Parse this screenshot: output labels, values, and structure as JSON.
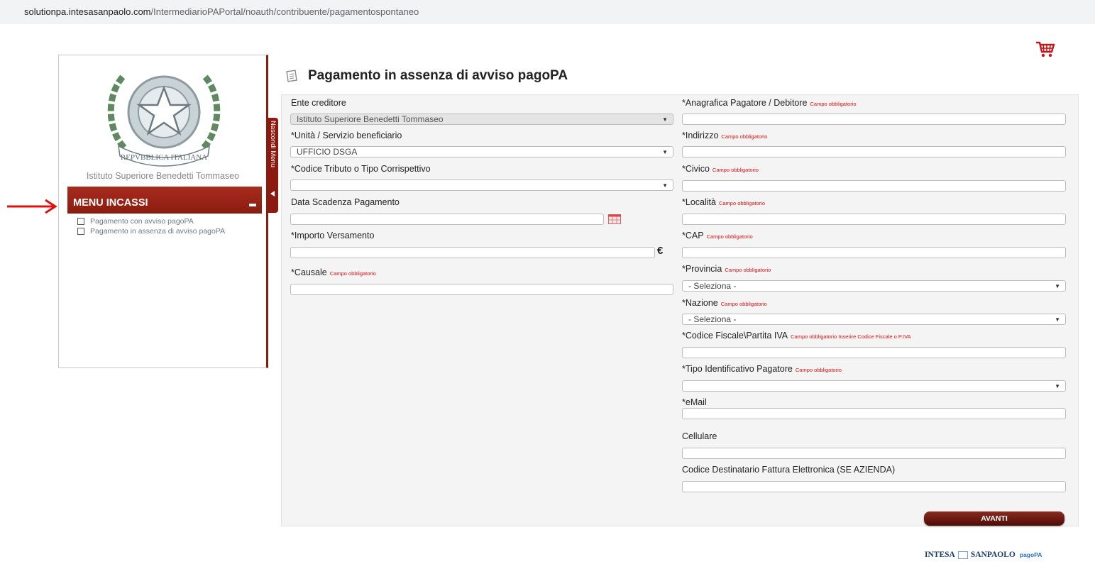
{
  "browser": {
    "url_host": "solutionpa.intesasanpaolo.com",
    "url_path": "/IntermediarioPAPortal/noauth/contribuente/pagamentospontaneo"
  },
  "sidebar": {
    "school_name": "Istituto Superiore Benedetti Tommaseo",
    "emblem_text": "REPVBBLICA ITALIANA",
    "menu_title": "MENU INCASSI",
    "items": [
      {
        "label": "Pagamento con avviso pagoPA"
      },
      {
        "label": "Pagamento in assenza di avviso pagoPA"
      }
    ],
    "toggle_label": "Nascondi Menu"
  },
  "page": {
    "title": "Pagamento in assenza di avviso pagoPA"
  },
  "form": {
    "required_note": "Campo obbligatorio",
    "left": {
      "ente_label": "Ente creditore",
      "ente_value": "Istituto Superiore Benedetti Tommaseo",
      "unita_label": "*Unità / Servizio beneficiario",
      "unita_value": "UFFICIO DSGA",
      "codice_label": "*Codice Tributo o Tipo Corrispettivo",
      "codice_value": "",
      "data_label": "Data Scadenza Pagamento",
      "importo_label": "*Importo Versamento",
      "importo_currency": "€",
      "causale_label": "*Causale"
    },
    "right": {
      "anagrafica_label": "*Anagrafica Pagatore / Debitore",
      "indirizzo_label": "*Indirizzo",
      "civico_label": "*Civico",
      "localita_label": "*Località",
      "cap_label": "*CAP",
      "provincia_label": "*Provincia",
      "provincia_value": "- Seleziona -",
      "nazione_label": "*Nazione",
      "nazione_value": "- Seleziona -",
      "cf_label": "*Codice Fiscale\\Partita IVA",
      "cf_note": "Campo obbligatorio Inserire Codice Fiscale o P.IVA",
      "tipo_label": "*Tipo Identificativo Pagatore",
      "email_label": "*eMail",
      "cellulare_label": "Cellulare",
      "sdi_label": "Codice Destinatario Fattura Elettronica (SE AZIENDA)"
    },
    "submit_label": "AVANTI"
  },
  "footer": {
    "brand_left": "INTESA",
    "brand_right": "SANPAOLO",
    "pagopa": "pagoPA"
  },
  "colors": {
    "brand_red": "#8b1a10",
    "required_red": "#dd1111"
  }
}
